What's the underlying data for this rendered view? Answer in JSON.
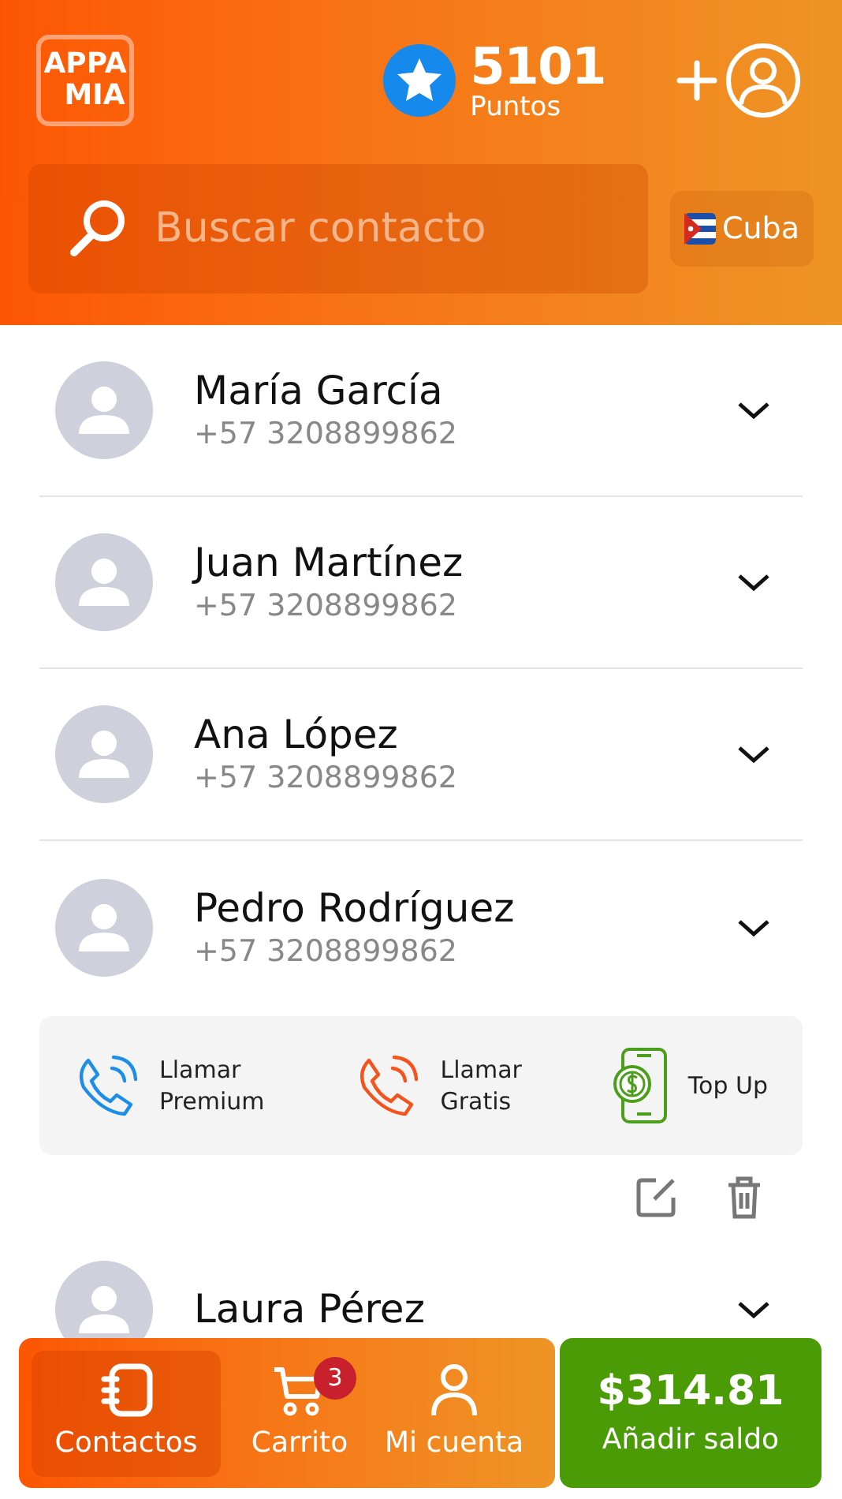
{
  "header": {
    "logo_lines": [
      "APPA",
      "MIA"
    ],
    "points": {
      "value": "5101",
      "label": "Puntos"
    },
    "search": {
      "placeholder": "Buscar contacto"
    },
    "country": {
      "label": "Cuba"
    }
  },
  "contacts": [
    {
      "name": "María García",
      "phone": "+57 3208899862"
    },
    {
      "name": "Juan Martínez",
      "phone": "+57 3208899862"
    },
    {
      "name": "Ana López",
      "phone": "+57 3208899862"
    },
    {
      "name": "Pedro Rodríguez",
      "phone": "+57 3208899862",
      "actions": [
        {
          "kind": "premium",
          "lines": [
            "Llamar",
            "Premium"
          ]
        },
        {
          "kind": "free",
          "lines": [
            "Llamar",
            "Gratis"
          ]
        },
        {
          "kind": "topup",
          "lines": [
            "Top Up"
          ]
        }
      ]
    },
    {
      "name": "Laura Pérez"
    }
  ],
  "bottom_nav": {
    "items": [
      {
        "kind": "contacts",
        "label": "Contactos",
        "selected": true
      },
      {
        "kind": "cart",
        "label": "Carrito",
        "selected": false,
        "badge": "3"
      },
      {
        "kind": "account",
        "label": "Mi cuenta",
        "selected": false
      }
    ],
    "balance": {
      "amount": "$314.81",
      "label": "Añadir saldo"
    }
  }
}
